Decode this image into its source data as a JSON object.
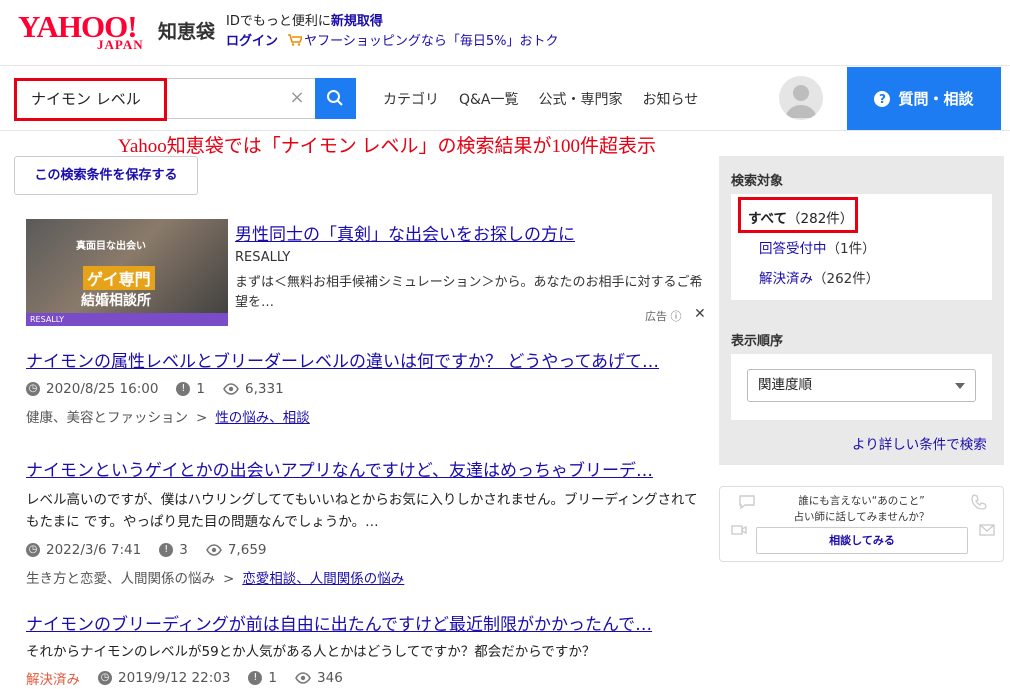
{
  "header": {
    "logo_yahoo": "YAHOO!",
    "logo_japan": "JAPAN",
    "logo_service": "知恵袋",
    "promo_prefix": "IDでもっと便利に",
    "promo_link": "新規取得",
    "login": "ログイン",
    "shopping_promo": "ヤフーショッピングなら「毎日5%」おトク"
  },
  "nav": {
    "search_value": "ナイモン レベル",
    "clear_symbol": "×",
    "links": [
      "カテゴリ",
      "Q&A一覧",
      "公式・専門家",
      "お知らせ"
    ],
    "ask_button": "質問・相談",
    "ask_icon": "?"
  },
  "annotation": "Yahoo知恵袋では「ナイモン レベル」の検索結果が100件超表示",
  "main": {
    "save_condition": "この検索条件を保存する",
    "ad": {
      "thumb_line1": "真面目な出会い",
      "thumb_badge": "ゲイ専門",
      "thumb_line3": "結婚相談所",
      "thumb_bar": "RESALLY",
      "title": "男性同士の「真剣」な出会いをお探しの方に",
      "source": "RESALLY",
      "description": "まずは＜無料お相手候補シミュレーション＞から。あなたのお相手に対するご希望を…",
      "label": "広告",
      "close": "✕"
    },
    "results": [
      {
        "title": "ナイモンの属性レベルとブリーダーレベルの違いは何ですか？ どうやってあげて…",
        "snippet": "",
        "status": "",
        "date": "2020/8/25 16:00",
        "answers": "1",
        "views": "6,331",
        "category": "健康、美容とファッション",
        "subcategory": "性の悩み、相談"
      },
      {
        "title": "ナイモンというゲイとかの出会いアプリなんですけど、友達はめっちゃブリーデ…",
        "snippet": "レベル高いのですが、僕はハウリングしててもいいねとからお気に入りしかされません。ブリーディングされてもたまに です。やっぱり見た目の問題なんでしょうか。…",
        "status": "",
        "date": "2022/3/6 7:41",
        "answers": "3",
        "views": "7,659",
        "category": "生き方と恋愛、人間関係の悩み",
        "subcategory": "恋愛相談、人間関係の悩み"
      },
      {
        "title": "ナイモンのブリーディングが前は自由に出たんですけど最近制限がかかったんで…",
        "snippet": "それからナイモンのレベルが59とか人気がある人とかはどうしてですか？都会だからですか？",
        "status": "解決済み",
        "date": "2019/9/12 22:03",
        "answers": "1",
        "views": "346",
        "category": "",
        "subcategory": ""
      }
    ]
  },
  "sidebar": {
    "target_heading": "検索対象",
    "all_label": "すべて",
    "all_count": "（282件）",
    "open_label": "回答受付中",
    "open_count": "（1件）",
    "solved_label": "解決済み",
    "solved_count": "（262件）",
    "order_heading": "表示順序",
    "order_value": "関連度順",
    "detail_search": "より詳しい条件で検索",
    "fortune_line1": "誰にも言えない“あのこと”",
    "fortune_line2": "占い師に話してみませんか？",
    "fortune_button": "相談してみる"
  },
  "colors": {
    "brand_red": "#ff0033",
    "accent_blue": "#1d7cf2",
    "link": "#1a0dab",
    "highlight": "#e60012"
  }
}
